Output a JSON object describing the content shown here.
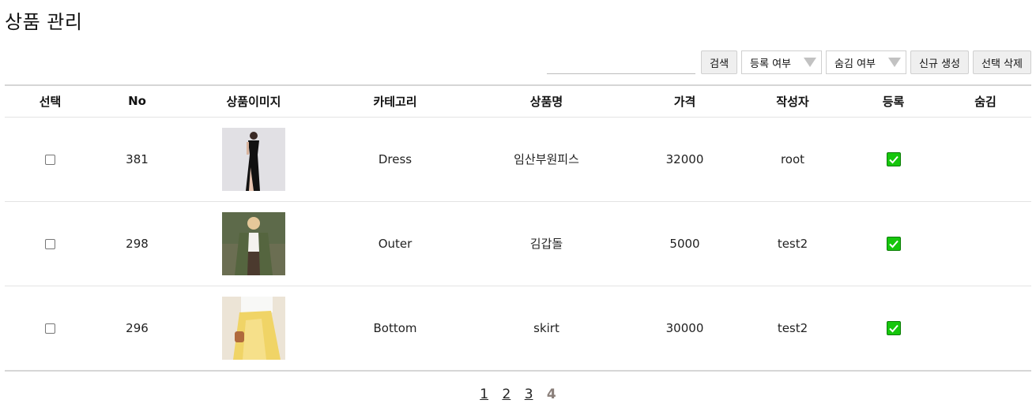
{
  "page": {
    "title": "상품 관리"
  },
  "toolbar": {
    "search_placeholder": "",
    "search_value": "",
    "search_label": "검색",
    "registration_filter": "등록 여부",
    "hidden_filter": "숨김 여부",
    "create_label": "신규 생성",
    "delete_label": "선택 삭제"
  },
  "table": {
    "headers": [
      "선택",
      "No",
      "상품이미지",
      "카테고리",
      "상품명",
      "가격",
      "작성자",
      "등록",
      "숨김"
    ],
    "rows": [
      {
        "no": "381",
        "category": "Dress",
        "name": "임산부원피스",
        "price": "32000",
        "author": "root",
        "registered": true,
        "hidden": false,
        "image": "black-dress-photo"
      },
      {
        "no": "298",
        "category": "Outer",
        "name": "김갑돌",
        "price": "5000",
        "author": "test2",
        "registered": true,
        "hidden": false,
        "image": "green-coat-photo"
      },
      {
        "no": "296",
        "category": "Bottom",
        "name": "skirt",
        "price": "30000",
        "author": "test2",
        "registered": true,
        "hidden": false,
        "image": "yellow-skirt-photo"
      }
    ]
  },
  "pagination": {
    "pages": [
      "1",
      "2",
      "3",
      "4"
    ],
    "current": "4"
  },
  "colors": {
    "check_green": "#16c60c",
    "current_page": "#8a7f7a"
  },
  "icons": {
    "registered": "checkmark-icon",
    "dropdown": "caret-down-icon"
  }
}
